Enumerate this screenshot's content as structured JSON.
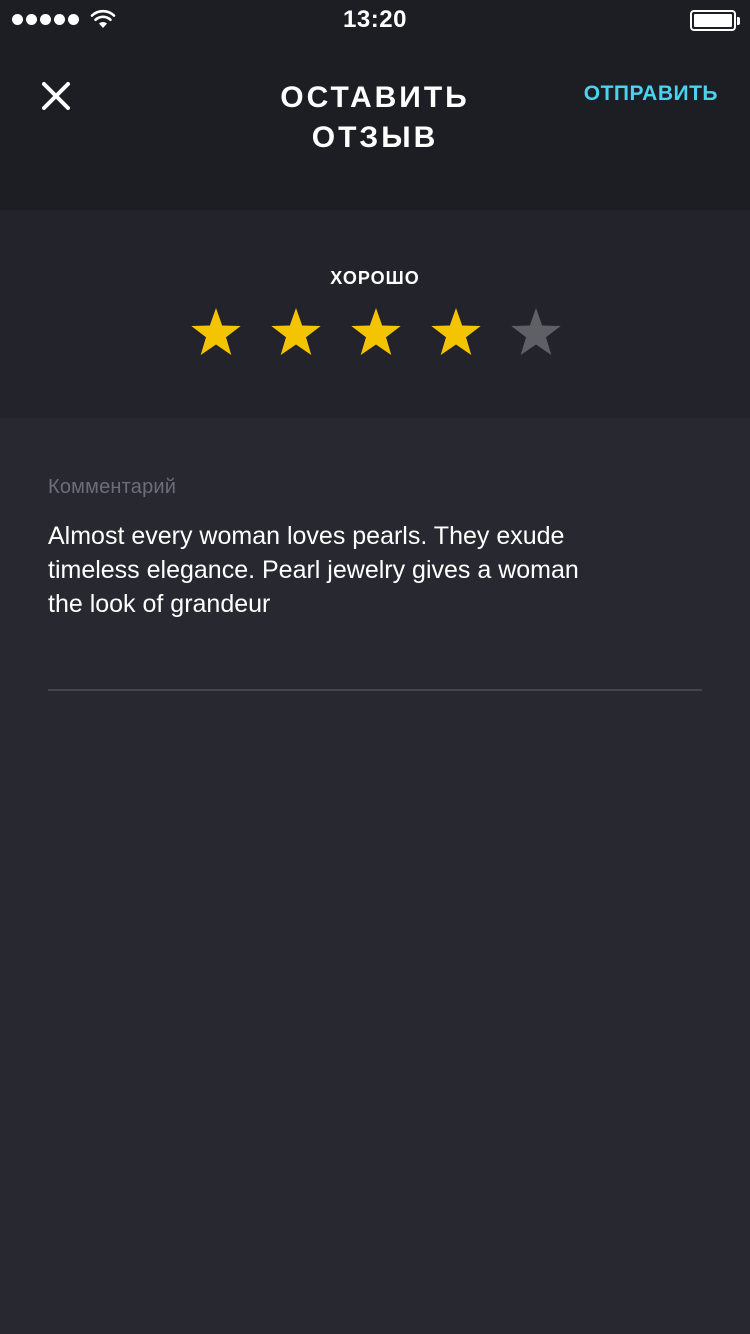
{
  "status_bar": {
    "time": "13:20",
    "signal_bars": 5,
    "wifi_icon": "wifi-icon",
    "battery_level": 1.0
  },
  "nav": {
    "close_icon": "close-icon",
    "title_line1": "ОСТАВИТЬ",
    "title_line2": "ОТЗЫВ",
    "send_label": "ОТПРАВИТЬ"
  },
  "rating": {
    "label": "ХОРОШО",
    "value": 4,
    "max": 5,
    "star_icon": "star-icon"
  },
  "comment": {
    "label": "Комментарий",
    "text": "Almost every woman loves pearls. They exude\ntimeless elegance. Pearl jewelry gives a woman\nthe look of grandeur"
  },
  "colors": {
    "background": "#282831",
    "header": "#1d1e23",
    "rating_panel": "#23242b",
    "accent": "#48d3f0",
    "star_active": "#f5c400",
    "star_inactive": "#5f5f66",
    "muted_text": "#6c6d76",
    "divider": "#44454d"
  }
}
